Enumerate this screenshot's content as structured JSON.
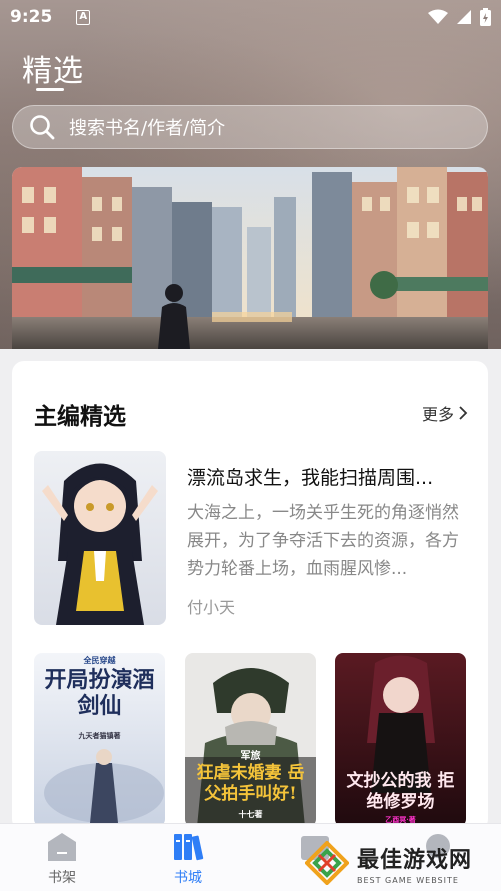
{
  "status_bar": {
    "time": "9:25",
    "notification_icon": "A"
  },
  "header": {
    "title": "精选"
  },
  "search": {
    "placeholder": "搜索书名/作者/简介"
  },
  "section": {
    "title": "主编精选",
    "more_label": "更多"
  },
  "featured_book": {
    "title": "漂流岛求生，我能扫描周围...",
    "description": "大海之上，一场关乎生死的角逐悄然展开，为了争夺活下去的资源，各方势力轮番上场，血雨腥风惨...",
    "author": "付小天"
  },
  "grid_books": [
    {
      "cover_label": "开局扮演酒剑仙",
      "cover_tag": "全民穿越",
      "cover_byline": "九天者猫镇著"
    },
    {
      "cover_label": "狂虐未婚妻 岳父拍手叫好!",
      "cover_tag": "军旅",
      "cover_byline": "十七著"
    },
    {
      "cover_label": "文抄公的我 拒绝修罗场",
      "cover_tag": "",
      "cover_byline": "乙酉冥·著"
    }
  ],
  "bottom_nav": [
    {
      "label": "书架",
      "active": false
    },
    {
      "label": "书城",
      "active": true
    }
  ],
  "watermark": {
    "title": "最佳游戏网",
    "subtitle": "BEST GAME WEBSITE"
  },
  "colors": {
    "accent": "#2f7ef6",
    "nav_inactive": "#666666"
  }
}
